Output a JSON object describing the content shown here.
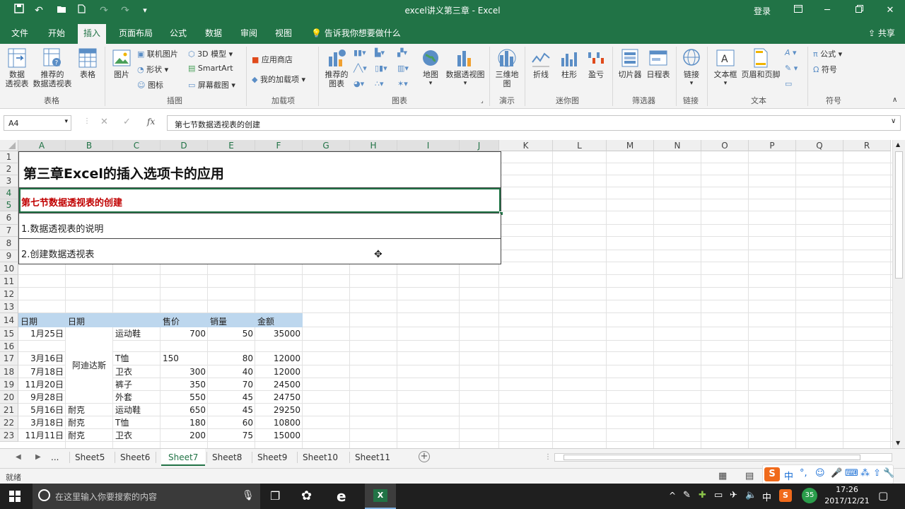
{
  "window": {
    "title": "excel讲义第三章  -  Excel",
    "login": "登录"
  },
  "tabs": [
    "文件",
    "开始",
    "插入",
    "页面布局",
    "公式",
    "数据",
    "审阅",
    "视图"
  ],
  "tell_me": "告诉我你想要做什么",
  "share": "共享",
  "ribbon": {
    "pivot_table": [
      "数据",
      "透视表"
    ],
    "recommended_pivot": [
      "推荐的",
      "数据透视表"
    ],
    "table": "表格",
    "picture": "图片",
    "online_picture": "联机图片",
    "shapes": "形状",
    "icons": "图标",
    "model_3d": "3D 模型",
    "smartart": "SmartArt",
    "screenshot": "屏幕截图",
    "app_store": "应用商店",
    "my_addins": "我的加载项",
    "recommended_charts": [
      "推荐的",
      "图表"
    ],
    "map": "地图",
    "pivot_chart": "数据透视图",
    "map_3d": [
      "三维地",
      "图"
    ],
    "line": "折线",
    "column": "柱形",
    "win_loss": "盈亏",
    "slicer": "切片器",
    "timeline": "日程表",
    "link": "链接",
    "textbox": "文本框",
    "header_footer": "页眉和页脚",
    "formula": "公式",
    "symbol": "符号",
    "groups": [
      "表格",
      "插图",
      "加载项",
      "图表",
      "演示",
      "迷你图",
      "筛选器",
      "链接",
      "文本",
      "符号"
    ]
  },
  "formula_bar": {
    "name_box": "A4",
    "content": "第七节数据透视表的创建"
  },
  "columns": [
    "A",
    "B",
    "C",
    "D",
    "E",
    "F",
    "G",
    "H",
    "I",
    "J",
    "K",
    "L",
    "M",
    "N",
    "O",
    "P",
    "Q",
    "R"
  ],
  "rows": [
    "1",
    "2",
    "3",
    "4",
    "5",
    "6",
    "7",
    "8",
    "9",
    "10",
    "11",
    "12",
    "13",
    "14",
    "15",
    "16",
    "17",
    "18",
    "19",
    "20",
    "21",
    "22",
    "23"
  ],
  "content": {
    "chapter_title": "第三章Excel的插入选项卡的应用",
    "section_title": "第七节数据透视表的创建",
    "item1": "1.数据透视表的说明",
    "item2": "2.创建数据透视表"
  },
  "table": {
    "headers": [
      "日期",
      "日期",
      "",
      "售价",
      "销量",
      "金额"
    ],
    "merged_brand": "阿迪达斯",
    "rows": [
      {
        "date": "1月25日",
        "brand": "",
        "item": "运动鞋",
        "price": "700",
        "qty": "50",
        "amount": "35000"
      },
      {
        "date": "",
        "brand": "",
        "item": "",
        "price": "",
        "qty": "",
        "amount": ""
      },
      {
        "date": "3月16日",
        "brand": "",
        "item": "T恤",
        "price": "150",
        "qty": "80",
        "amount": "12000"
      },
      {
        "date": "7月18日",
        "brand": "",
        "item": "卫衣",
        "price": "300",
        "qty": "40",
        "amount": "12000"
      },
      {
        "date": "11月20日",
        "brand": "",
        "item": "裤子",
        "price": "350",
        "qty": "70",
        "amount": "24500"
      },
      {
        "date": "9月28日",
        "brand": "",
        "item": "外套",
        "price": "550",
        "qty": "45",
        "amount": "24750"
      },
      {
        "date": "5月16日",
        "brand": "耐克",
        "item": "运动鞋",
        "price": "650",
        "qty": "45",
        "amount": "29250"
      },
      {
        "date": "3月18日",
        "brand": "耐克",
        "item": "T恤",
        "price": "180",
        "qty": "60",
        "amount": "10800"
      },
      {
        "date": "11月11日",
        "brand": "耐克",
        "item": "卫衣",
        "price": "200",
        "qty": "75",
        "amount": "15000"
      }
    ]
  },
  "sheets": [
    "...",
    "Sheet5",
    "Sheet6",
    "Sheet7",
    "Sheet8",
    "Sheet9",
    "Sheet10",
    "Sheet11"
  ],
  "active_sheet": "Sheet7",
  "status": "就绪",
  "taskbar": {
    "search_placeholder": "在这里输入你要搜索的内容",
    "time": "17:26",
    "date": "2017/12/21",
    "ime": "中",
    "badge": "35"
  },
  "colors": {
    "excel_green": "#217346",
    "header_fill": "#bdd7ee",
    "red_text": "#c00000"
  }
}
